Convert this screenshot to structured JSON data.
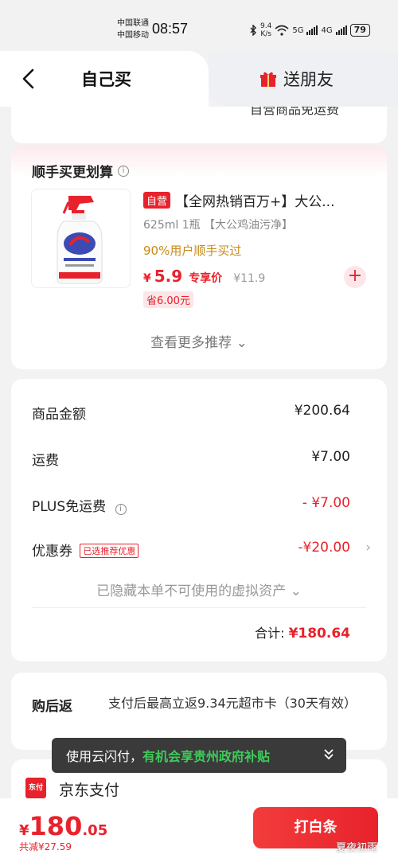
{
  "status_bar": {
    "carrier1": "中国联通",
    "carrier2": "中国移动",
    "time": "08:57",
    "net_speed_top": "9.4",
    "net_speed_bottom": "K/s",
    "signal1": "5G",
    "signal2": "4G",
    "battery": "79"
  },
  "header": {
    "tab_self": "自己买",
    "tab_friend": "送朋友"
  },
  "clipped_text": "自营商品免运费",
  "recommend": {
    "title": "顺手买更划算",
    "product": {
      "tag": "自营",
      "title": "【全网热销百万+】大公...",
      "spec": "625ml 1瓶 【大公鸡油污净】",
      "bought": "90%用户顺手买过",
      "price_currency": "¥",
      "price": "5.9",
      "price_label": "专享价",
      "original_price": "¥11.9",
      "save": "省6.00元"
    },
    "more": "查看更多推荐 ⌄"
  },
  "summary": {
    "rows": [
      {
        "label": "商品金额",
        "value": "¥200.64"
      },
      {
        "label": "运费",
        "value": "¥7.00"
      },
      {
        "label": "PLUS免运费",
        "value": "- ¥7.00"
      },
      {
        "label": "优惠券",
        "tag": "已选推荐优惠",
        "value": "-¥20.00"
      }
    ],
    "hidden_assets": "已隐藏本单不可使用的虚拟资产 ⌄",
    "total_label": "合计:",
    "total_value": "¥180.64"
  },
  "rebate": {
    "label": "购后返",
    "text": "支付后最高立返9.34元超市卡（30天有效）"
  },
  "toast": {
    "prefix": "使用云闪付，",
    "highlight": "有机会享贵州政府补贴"
  },
  "payment": {
    "icon_text": "东付",
    "label": "京东支付"
  },
  "bottom": {
    "currency": "¥",
    "total_int": "180",
    "total_dec": ".05",
    "discount": "共减¥27.59",
    "pay_button": "打白条",
    "watermark": "夏夜初雨"
  },
  "colors": {
    "accent": "#e8222c",
    "gold": "#c98a16",
    "success_green": "#3ecb5a"
  }
}
